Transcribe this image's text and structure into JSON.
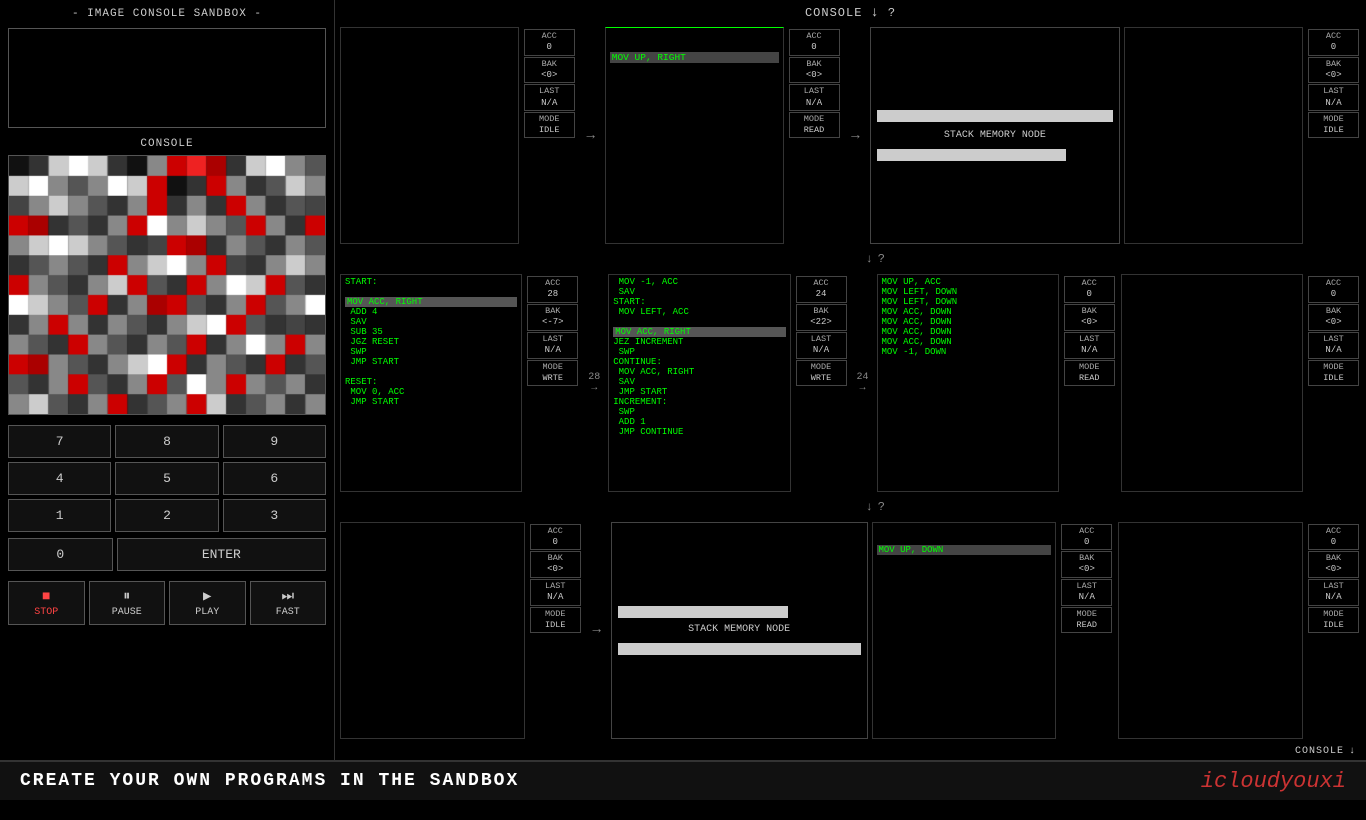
{
  "app": {
    "title": "- IMAGE CONSOLE SANDBOX -",
    "console_label": "CONSOLE",
    "banner_text": "CREATE YOUR OWN PROGRAMS IN THE SANDBOX",
    "brand_text": "icloudyouxi",
    "help_symbol": "?"
  },
  "controls": {
    "numpad": [
      "7",
      "8",
      "9",
      "4",
      "5",
      "6",
      "1",
      "2",
      "3"
    ],
    "zero": "0",
    "enter": "ENTER",
    "stop": "STOP",
    "pause": "PAUSE",
    "play": "PLAY",
    "fast": "FAST"
  },
  "row1": {
    "node1": {
      "code": "",
      "acc": "0",
      "bak": "<0>",
      "last": "N/A",
      "mode": "IDLE"
    },
    "arrow": "→",
    "node2": {
      "title": "MOV UP, RIGHT",
      "code": "",
      "acc": "0",
      "bak": "<0>",
      "last": "N/A",
      "mode": "READ"
    },
    "arrow2": "→",
    "stack_node": {
      "label": "STACK MEMORY NODE"
    },
    "node4": {
      "code": "",
      "acc": "0",
      "bak": "<0>",
      "last": "N/A",
      "mode": "IDLE"
    }
  },
  "connector1": {
    "down_arrow": "↓",
    "help": "?"
  },
  "row2": {
    "node1": {
      "code": "START:\n MOV ACC, RIGHT\n ADD 4\n SAV\n SUB 35\n JGZ RESET\n SWP\n JMP START\n\nRESET:\n MOV 0, ACC\n JMP START",
      "highlighted": "MOV ACC, RIGHT",
      "acc": "28",
      "bak": "<-7>",
      "last": "N/A",
      "mode": "WRTE",
      "acc_val": "28"
    },
    "arrow": "→",
    "node2": {
      "code": " MOV -1, ACC\n SAV\nSTART:\n MOV LEFT, ACC\n MOV ACC, RIGHT\nJEZ INCREMENT\n SWP\nCONTINUE:\n MOV ACC, RIGHT\n SAV\n JMP START\nINCREMENT:\n SWP\n ADD 1\n JMP CONTINUE",
      "highlighted": "MOV ACC, RIGHT",
      "acc": "24",
      "bak": "<22>",
      "last": "N/A",
      "mode": "WRTE",
      "acc_val": "24"
    },
    "arrow_val1": "28",
    "arrow_val2": "24",
    "node3": {
      "code": "MOV UP, ACC\nMOV LEFT, DOWN\nMOV LEFT, DOWN\nMOV ACC, DOWN\nMOV ACC, DOWN\nMOV ACC, DOWN\nMOV ACC, DOWN\nMOV -1, DOWN",
      "acc": "0",
      "bak": "<0>",
      "last": "N/A",
      "mode": "READ"
    },
    "node4": {
      "code": "",
      "acc": "0",
      "bak": "<0>",
      "last": "N/A",
      "mode": "IDLE"
    }
  },
  "connector2": {
    "down_arrow": "↓",
    "help": "?"
  },
  "row3": {
    "node1": {
      "code": "",
      "acc": "0",
      "bak": "<0>",
      "last": "N/A",
      "mode": "IDLE"
    },
    "arrow": "→",
    "stack_node": {
      "label": "STACK MEMORY NODE"
    },
    "node3": {
      "title": "MOV UP, DOWN",
      "code": "MOV UP, DOWN",
      "acc": "0",
      "bak": "<0>",
      "last": "N/A",
      "mode": "READ"
    },
    "node4": {
      "code": "",
      "acc": "0",
      "bak": "<0>",
      "last": "N/A",
      "mode": "IDLE"
    }
  },
  "bottom_console": {
    "label": "CONSOLE",
    "down_arrow": "↓"
  },
  "pixels": [
    [
      "#111",
      "#333",
      "#ccc",
      "#fff",
      "#ccc",
      "#333",
      "#111",
      "#888",
      "#cc0000",
      "#ee2222",
      "#aa0000",
      "#333",
      "#ccc",
      "#fff",
      "#888",
      "#555"
    ],
    [
      "#ccc",
      "#fff",
      "#888",
      "#555",
      "#888",
      "#fff",
      "#ccc",
      "#cc0000",
      "#111",
      "#333",
      "#cc0000",
      "#888",
      "#333",
      "#555",
      "#ccc",
      "#888"
    ],
    [
      "#444",
      "#888",
      "#ccc",
      "#888",
      "#555",
      "#333",
      "#888",
      "#cc0000",
      "#333",
      "#888",
      "#333",
      "#cc0000",
      "#888",
      "#333",
      "#555",
      "#444"
    ],
    [
      "#cc0000",
      "#aa0000",
      "#333",
      "#555",
      "#333",
      "#888",
      "#cc0000",
      "#fff",
      "#888",
      "#ccc",
      "#888",
      "#555",
      "#cc0000",
      "#888",
      "#333",
      "#cc0000"
    ],
    [
      "#888",
      "#ccc",
      "#fff",
      "#ccc",
      "#888",
      "#555",
      "#333",
      "#444",
      "#cc0000",
      "#aa0000",
      "#333",
      "#888",
      "#555",
      "#333",
      "#888",
      "#555"
    ],
    [
      "#333",
      "#555",
      "#888",
      "#555",
      "#333",
      "#cc0000",
      "#888",
      "#ccc",
      "#fff",
      "#888",
      "#cc0000",
      "#444",
      "#333",
      "#888",
      "#ccc",
      "#888"
    ],
    [
      "#cc0000",
      "#888",
      "#555",
      "#333",
      "#888",
      "#ccc",
      "#cc0000",
      "#555",
      "#333",
      "#cc0000",
      "#888",
      "#fff",
      "#ccc",
      "#cc0000",
      "#555",
      "#333"
    ],
    [
      "#fff",
      "#ccc",
      "#888",
      "#555",
      "#cc0000",
      "#333",
      "#888",
      "#aa0000",
      "#cc0000",
      "#555",
      "#333",
      "#888",
      "#cc0000",
      "#555",
      "#888",
      "#fff"
    ],
    [
      "#333",
      "#888",
      "#cc0000",
      "#888",
      "#333",
      "#888",
      "#555",
      "#333",
      "#888",
      "#ccc",
      "#fff",
      "#cc0000",
      "#555",
      "#333",
      "#444",
      "#333"
    ],
    [
      "#888",
      "#555",
      "#333",
      "#cc0000",
      "#888",
      "#555",
      "#333",
      "#888",
      "#555",
      "#cc0000",
      "#333",
      "#888",
      "#fff",
      "#888",
      "#cc0000",
      "#888"
    ],
    [
      "#cc0000",
      "#aa0000",
      "#888",
      "#555",
      "#333",
      "#888",
      "#ccc",
      "#fff",
      "#cc0000",
      "#333",
      "#888",
      "#555",
      "#333",
      "#cc0000",
      "#333",
      "#555"
    ],
    [
      "#555",
      "#333",
      "#888",
      "#cc0000",
      "#555",
      "#333",
      "#888",
      "#cc0000",
      "#555",
      "#fff",
      "#888",
      "#cc0000",
      "#888",
      "#555",
      "#888",
      "#333"
    ],
    [
      "#888",
      "#ccc",
      "#555",
      "#333",
      "#888",
      "#cc0000",
      "#333",
      "#555",
      "#888",
      "#cc0000",
      "#ccc",
      "#333",
      "#555",
      "#888",
      "#333",
      "#888"
    ]
  ]
}
